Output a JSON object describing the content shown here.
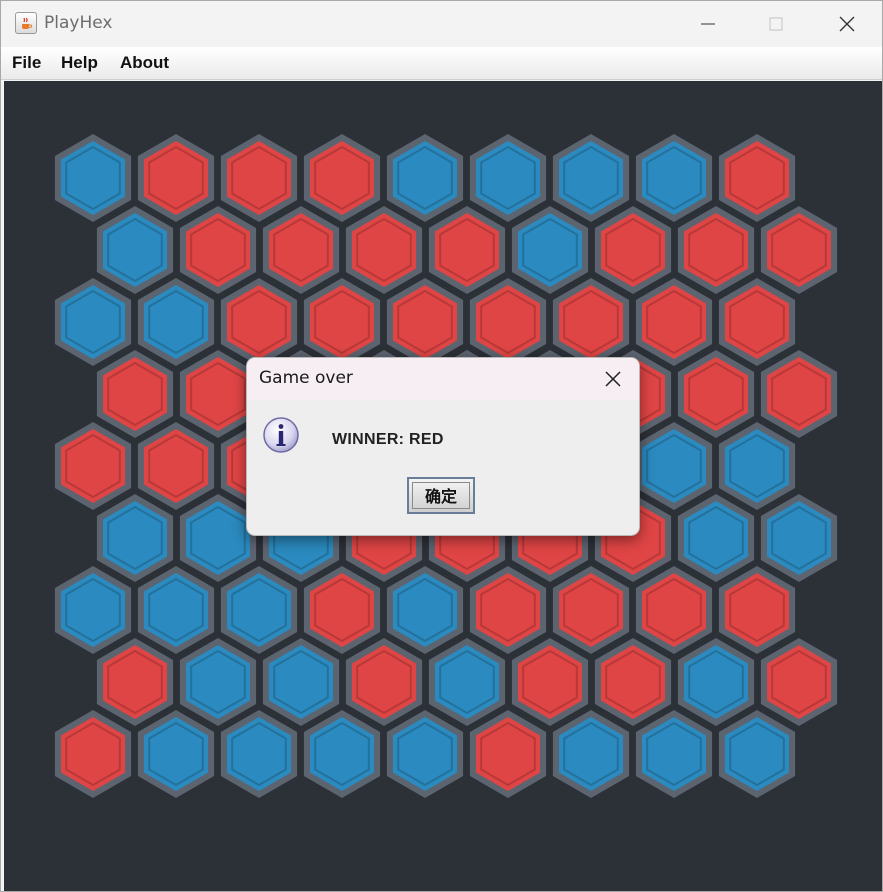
{
  "window": {
    "title": "PlayHex"
  },
  "menu": {
    "items": [
      "File",
      "Help",
      "About"
    ]
  },
  "board": {
    "size": 9,
    "colors": {
      "red": "#e04545",
      "blue": "#2b8abf",
      "border": "#5c6470",
      "background": "#2c3037"
    },
    "rows": [
      "BRRRBBBBR",
      "BRRRRBRRR",
      "BBRRRRRRR",
      "RRRRRRRRR",
      "RRRRRRBBB",
      "BBBRRRRBB",
      "BBBRBRRRR",
      "RBBRBRRBR",
      "RBBBBRBBB"
    ]
  },
  "dialog": {
    "title": "Game over",
    "icon": "info-icon",
    "message": "WINNER: RED",
    "ok_label": "确定"
  }
}
